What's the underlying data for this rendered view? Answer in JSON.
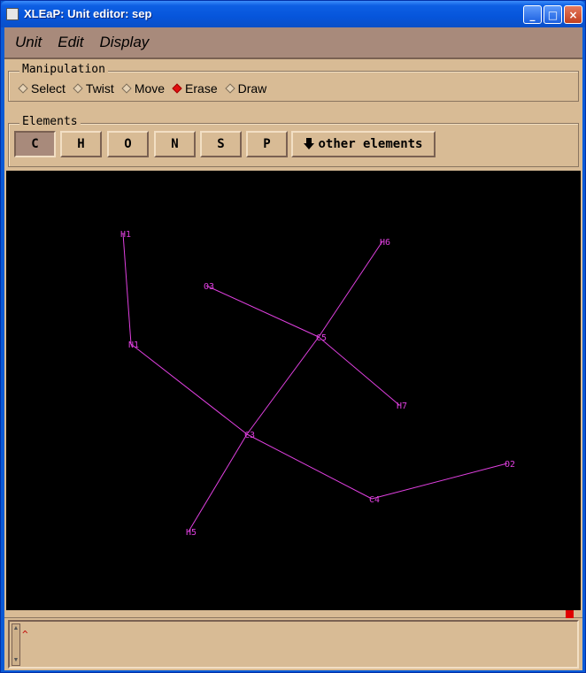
{
  "window": {
    "title": "XLEaP: Unit editor: sep",
    "controls": {
      "minimize": "_",
      "maximize": "□",
      "close": "×"
    }
  },
  "menu": [
    "Unit",
    "Edit",
    "Display"
  ],
  "manipulation": {
    "label": "Manipulation",
    "options": [
      "Select",
      "Twist",
      "Move",
      "Erase",
      "Draw"
    ],
    "selected": "Erase"
  },
  "elements": {
    "label": "Elements",
    "buttons": [
      "C",
      "H",
      "O",
      "N",
      "S",
      "P"
    ],
    "pressed": "C",
    "other_label": "other elements"
  },
  "molecule": {
    "color": "#e040e0",
    "atoms": [
      {
        "id": "H1",
        "label": "H1"
      },
      {
        "id": "N1",
        "label": "N1"
      },
      {
        "id": "C3",
        "label": "C3"
      },
      {
        "id": "C4",
        "label": "C4"
      },
      {
        "id": "O2",
        "label": "O2"
      },
      {
        "id": "H5",
        "label": "H5"
      },
      {
        "id": "C5",
        "label": "C5"
      },
      {
        "id": "H6",
        "label": "H6"
      },
      {
        "id": "O3",
        "label": "O3"
      },
      {
        "id": "H7",
        "label": "H7"
      }
    ],
    "bonds": [
      [
        "H1",
        "N1"
      ],
      [
        "N1",
        "C3"
      ],
      [
        "C3",
        "C4"
      ],
      [
        "C4",
        "O2"
      ],
      [
        "C3",
        "H5"
      ],
      [
        "C3",
        "C5"
      ],
      [
        "C5",
        "H6"
      ],
      [
        "O3",
        "C5"
      ],
      [
        "C5",
        "H7"
      ]
    ]
  },
  "console": {
    "prompt": "^"
  }
}
